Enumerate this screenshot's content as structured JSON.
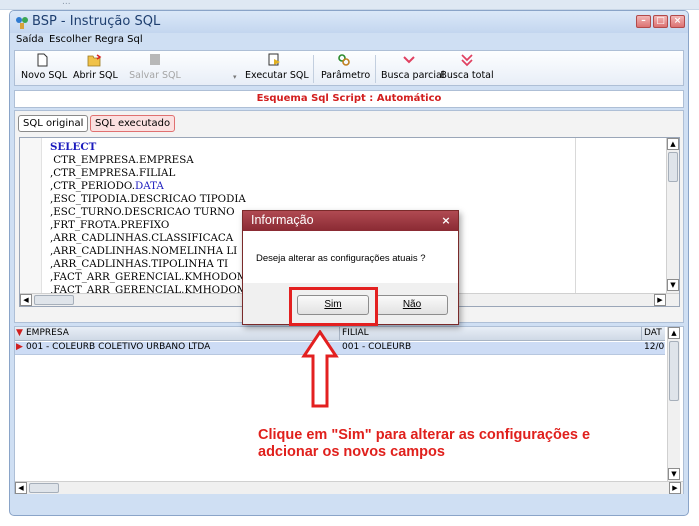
{
  "window": {
    "title": "BSP - Instrução SQL"
  },
  "menu": [
    "Saída",
    "Escolher Regra Sql"
  ],
  "toolbar": [
    {
      "label": "Novo SQL",
      "icon": "new-document-icon",
      "enabled": true
    },
    {
      "label": "Abrir SQL",
      "icon": "open-folder-icon",
      "enabled": true
    },
    {
      "label": "Salvar SQL",
      "icon": "save-icon",
      "enabled": false
    },
    {
      "label": "Executar SQL",
      "icon": "execute-icon",
      "enabled": true
    },
    {
      "label": "Parâmetro",
      "icon": "parameter-icon",
      "enabled": true
    },
    {
      "label": "Busca parcial",
      "icon": "partial-search-icon",
      "enabled": true
    },
    {
      "label": "Busca total",
      "icon": "total-search-icon",
      "enabled": true
    }
  ],
  "schema_label": "Esquema Sql Script : Automático",
  "tabs": [
    "SQL original",
    "SQL executado"
  ],
  "sql_lines": [
    "SELECT",
    " CTR_EMPRESA.EMPRESA",
    ",CTR_EMPRESA.FILIAL",
    ",CTR_PERIODO.DATA",
    ",ESC_TIPODIA.DESCRICAO TIPODIA",
    ",ESC_TURNO.DESCRICAO TURNO",
    ",FRT_FROTA.PREFIXO",
    ",ARR_CADLINHAS.CLASSIFICACA",
    ",ARR_CADLINHAS.NOMELINHA LI",
    ",ARR_CADLINHAS.TIPOLINHA TI",
    ",FACT_ARR_GERENCIAL.KMHODOM",
    ",FACT_ARR_GERENCIAL.KMHODOM"
  ],
  "grid": {
    "columns": [
      "EMPRESA",
      "FILIAL",
      "DAT"
    ],
    "rows": [
      [
        "001 - COLEURB COLETIVO URBANO LTDA",
        "001 - COLEURB",
        "12/0"
      ]
    ]
  },
  "dialog": {
    "title": "Informação",
    "message": "Deseja alterar as configurações atuais ?",
    "yes_label": "Sim",
    "no_label": "Não"
  },
  "annotation": "Clique em \"Sim\" para alterar as configurações e adcionar os novos campos",
  "colors": {
    "annotation": "#e0201c",
    "highlight": "#e32020",
    "schema_text": "#d21e1e"
  }
}
